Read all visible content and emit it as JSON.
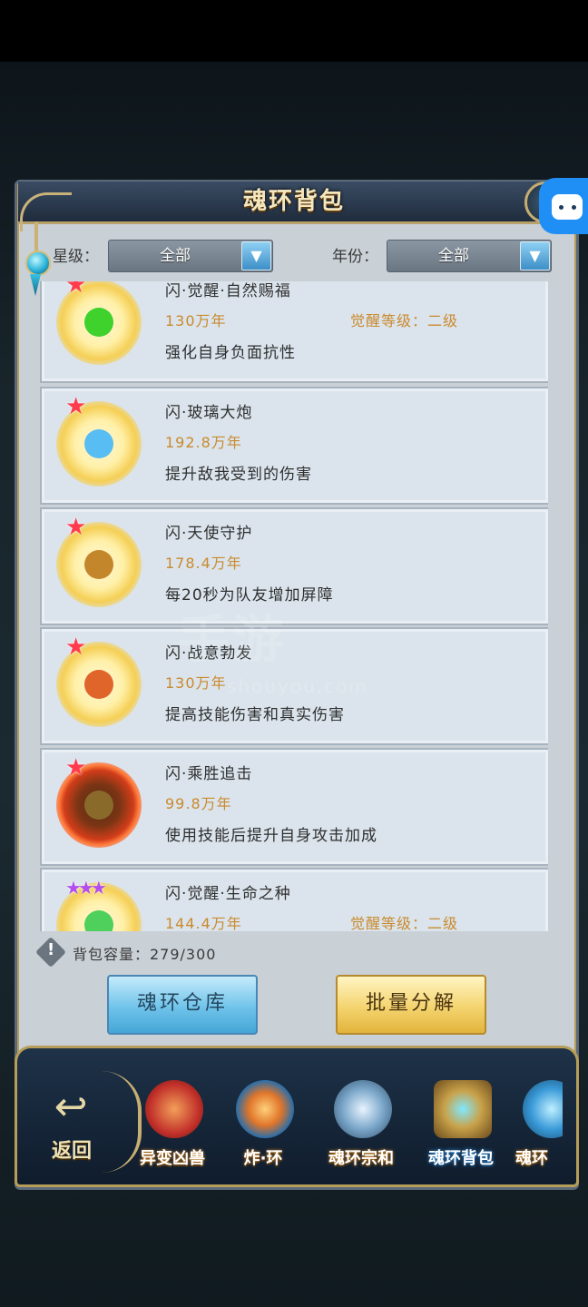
{
  "title": "魂环背包",
  "filters": {
    "star_label": "星级：",
    "star_value": "全部",
    "year_label": "年份：",
    "year_value": "全部"
  },
  "items": [
    {
      "name": "闪·觉醒·自然赐福",
      "years": "130万年",
      "awaken": "觉醒等级：二级",
      "desc": "强化自身负面抗性",
      "stars": "★",
      "star_color": "red",
      "core_color": "#3fd12c"
    },
    {
      "name": "闪·玻璃大炮",
      "years": "192.8万年",
      "awaken": "",
      "desc": "提升敌我受到的伤害",
      "stars": "★",
      "star_color": "red",
      "core_color": "#57bdf2"
    },
    {
      "name": "闪·天使守护",
      "years": "178.4万年",
      "awaken": "",
      "desc": "每20秒为队友增加屏障",
      "stars": "★",
      "star_color": "red",
      "core_color": "#c4862a"
    },
    {
      "name": "闪·战意勃发",
      "years": "130万年",
      "awaken": "",
      "desc": "提高技能伤害和真实伤害",
      "stars": "★",
      "star_color": "red",
      "core_color": "#e0652a"
    },
    {
      "name": "闪·乘胜追击",
      "years": "99.8万年",
      "awaken": "",
      "desc": "使用技能后提升自身攻击加成",
      "stars": "★",
      "star_color": "red",
      "core_color": "#8a6a2a"
    },
    {
      "name": "闪·觉醒·生命之种",
      "years": "144.4万年",
      "awaken": "觉醒等级：二级",
      "desc": "",
      "stars": "★★★",
      "star_color": "purple",
      "core_color": "#4fcf5b"
    }
  ],
  "capacity": "背包容量：279/300",
  "buttons": {
    "warehouse": "魂环仓库",
    "decompose": "批量分解"
  },
  "nav": {
    "back": "返回",
    "items": [
      {
        "label": "异变凶兽",
        "icon": "beast-icon",
        "color": "#c2302a"
      },
      {
        "label": "炸·环",
        "icon": "ring-burst-icon",
        "color": "#e0752a"
      },
      {
        "label": "魂环宗和",
        "icon": "trident-icon",
        "color": "#7aa6c9"
      },
      {
        "label": "魂环背包",
        "icon": "bag-icon",
        "color": "#c9a24a"
      },
      {
        "label": "魂环",
        "icon": "ring-icon",
        "color": "#3a9ad8"
      }
    ]
  },
  "watermark": {
    "main": "手游",
    "sub": "shouyou.com"
  }
}
